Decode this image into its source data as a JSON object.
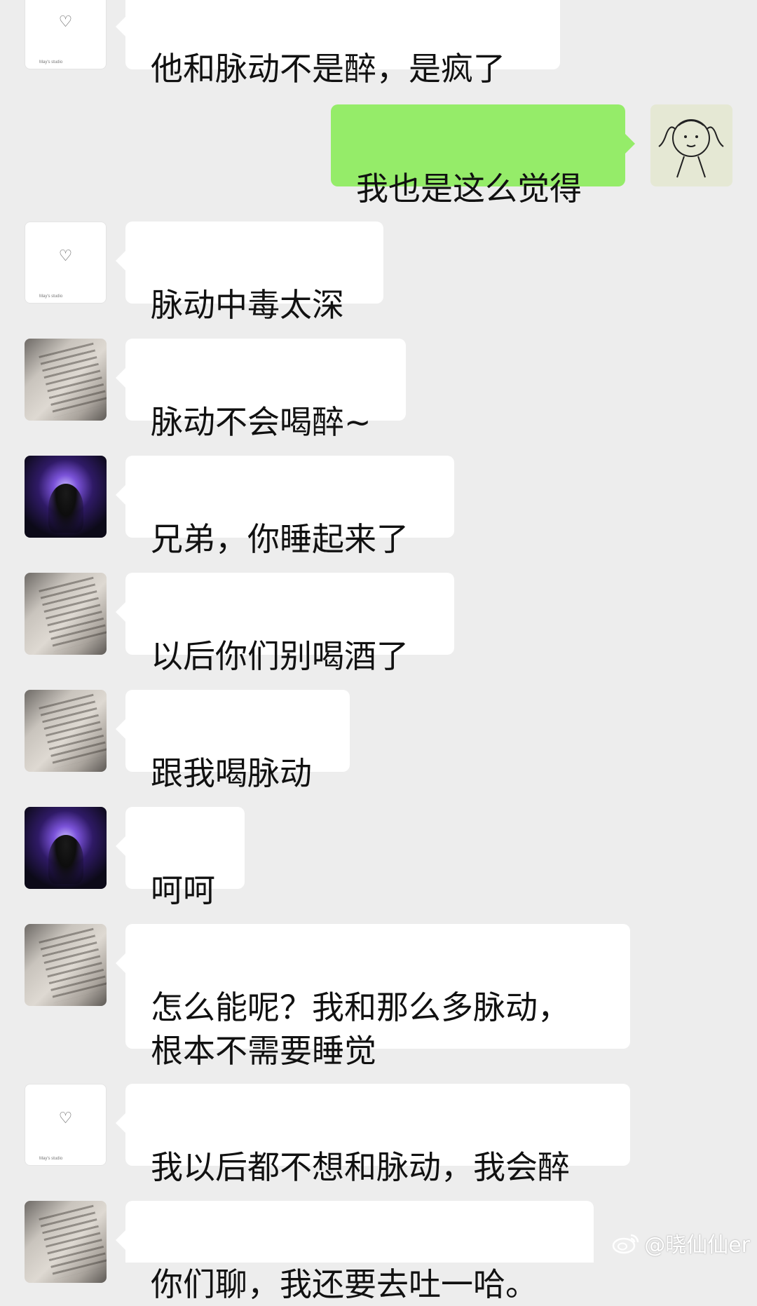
{
  "messages": [
    {
      "side": "left",
      "avatar": "studio",
      "text": "他和脉动不是醉，是疯了"
    },
    {
      "side": "right",
      "avatar": "sketch",
      "text": "我也是这么觉得"
    },
    {
      "side": "left",
      "avatar": "studio",
      "text": "脉动中毒太深"
    },
    {
      "side": "left",
      "avatar": "book",
      "text": "脉动不会喝醉~"
    },
    {
      "side": "left",
      "avatar": "dark",
      "text": "兄弟，你睡起来了"
    },
    {
      "side": "left",
      "avatar": "book",
      "text": "以后你们别喝酒了"
    },
    {
      "side": "left",
      "avatar": "book",
      "text": "跟我喝脉动"
    },
    {
      "side": "left",
      "avatar": "dark",
      "text": "呵呵"
    },
    {
      "side": "left",
      "avatar": "book",
      "text": "怎么能呢？我和那么多脉动，\n根本不需要睡觉"
    },
    {
      "side": "left",
      "avatar": "studio",
      "text": "我以后都不想和脉动，我会醉"
    },
    {
      "side": "left",
      "avatar": "book",
      "text": "你们聊，我还要去吐一哈。"
    }
  ],
  "avatar_studio": {
    "heart": "♡",
    "brand": "May's studio"
  },
  "watermark": {
    "icon": "weibo-icon",
    "text": "@晓仙仙er"
  },
  "colors": {
    "background": "#ededed",
    "bubble_left": "#ffffff",
    "bubble_right": "#95ec69"
  }
}
